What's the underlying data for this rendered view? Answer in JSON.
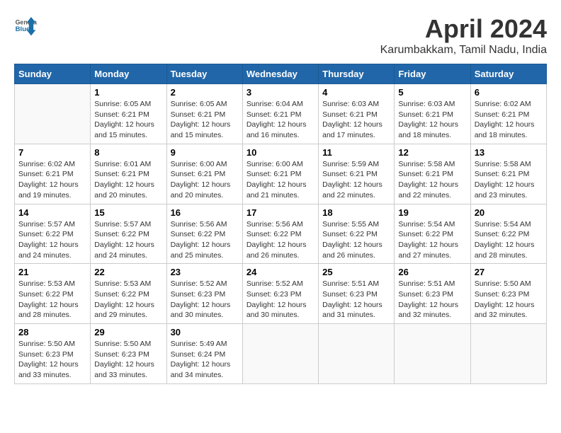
{
  "header": {
    "logo": {
      "line1": "General",
      "line2": "Blue"
    },
    "title": "April 2024",
    "location": "Karumbakkam, Tamil Nadu, India"
  },
  "weekdays": [
    "Sunday",
    "Monday",
    "Tuesday",
    "Wednesday",
    "Thursday",
    "Friday",
    "Saturday"
  ],
  "weeks": [
    [
      {
        "day": "",
        "sunrise": "",
        "sunset": "",
        "daylight": ""
      },
      {
        "day": "1",
        "sunrise": "6:05 AM",
        "sunset": "6:21 PM",
        "daylight": "12 hours and 15 minutes."
      },
      {
        "day": "2",
        "sunrise": "6:05 AM",
        "sunset": "6:21 PM",
        "daylight": "12 hours and 15 minutes."
      },
      {
        "day": "3",
        "sunrise": "6:04 AM",
        "sunset": "6:21 PM",
        "daylight": "12 hours and 16 minutes."
      },
      {
        "day": "4",
        "sunrise": "6:03 AM",
        "sunset": "6:21 PM",
        "daylight": "12 hours and 17 minutes."
      },
      {
        "day": "5",
        "sunrise": "6:03 AM",
        "sunset": "6:21 PM",
        "daylight": "12 hours and 18 minutes."
      },
      {
        "day": "6",
        "sunrise": "6:02 AM",
        "sunset": "6:21 PM",
        "daylight": "12 hours and 18 minutes."
      }
    ],
    [
      {
        "day": "7",
        "sunrise": "6:02 AM",
        "sunset": "6:21 PM",
        "daylight": "12 hours and 19 minutes."
      },
      {
        "day": "8",
        "sunrise": "6:01 AM",
        "sunset": "6:21 PM",
        "daylight": "12 hours and 20 minutes."
      },
      {
        "day": "9",
        "sunrise": "6:00 AM",
        "sunset": "6:21 PM",
        "daylight": "12 hours and 20 minutes."
      },
      {
        "day": "10",
        "sunrise": "6:00 AM",
        "sunset": "6:21 PM",
        "daylight": "12 hours and 21 minutes."
      },
      {
        "day": "11",
        "sunrise": "5:59 AM",
        "sunset": "6:21 PM",
        "daylight": "12 hours and 22 minutes."
      },
      {
        "day": "12",
        "sunrise": "5:58 AM",
        "sunset": "6:21 PM",
        "daylight": "12 hours and 22 minutes."
      },
      {
        "day": "13",
        "sunrise": "5:58 AM",
        "sunset": "6:21 PM",
        "daylight": "12 hours and 23 minutes."
      }
    ],
    [
      {
        "day": "14",
        "sunrise": "5:57 AM",
        "sunset": "6:22 PM",
        "daylight": "12 hours and 24 minutes."
      },
      {
        "day": "15",
        "sunrise": "5:57 AM",
        "sunset": "6:22 PM",
        "daylight": "12 hours and 24 minutes."
      },
      {
        "day": "16",
        "sunrise": "5:56 AM",
        "sunset": "6:22 PM",
        "daylight": "12 hours and 25 minutes."
      },
      {
        "day": "17",
        "sunrise": "5:56 AM",
        "sunset": "6:22 PM",
        "daylight": "12 hours and 26 minutes."
      },
      {
        "day": "18",
        "sunrise": "5:55 AM",
        "sunset": "6:22 PM",
        "daylight": "12 hours and 26 minutes."
      },
      {
        "day": "19",
        "sunrise": "5:54 AM",
        "sunset": "6:22 PM",
        "daylight": "12 hours and 27 minutes."
      },
      {
        "day": "20",
        "sunrise": "5:54 AM",
        "sunset": "6:22 PM",
        "daylight": "12 hours and 28 minutes."
      }
    ],
    [
      {
        "day": "21",
        "sunrise": "5:53 AM",
        "sunset": "6:22 PM",
        "daylight": "12 hours and 28 minutes."
      },
      {
        "day": "22",
        "sunrise": "5:53 AM",
        "sunset": "6:22 PM",
        "daylight": "12 hours and 29 minutes."
      },
      {
        "day": "23",
        "sunrise": "5:52 AM",
        "sunset": "6:23 PM",
        "daylight": "12 hours and 30 minutes."
      },
      {
        "day": "24",
        "sunrise": "5:52 AM",
        "sunset": "6:23 PM",
        "daylight": "12 hours and 30 minutes."
      },
      {
        "day": "25",
        "sunrise": "5:51 AM",
        "sunset": "6:23 PM",
        "daylight": "12 hours and 31 minutes."
      },
      {
        "day": "26",
        "sunrise": "5:51 AM",
        "sunset": "6:23 PM",
        "daylight": "12 hours and 32 minutes."
      },
      {
        "day": "27",
        "sunrise": "5:50 AM",
        "sunset": "6:23 PM",
        "daylight": "12 hours and 32 minutes."
      }
    ],
    [
      {
        "day": "28",
        "sunrise": "5:50 AM",
        "sunset": "6:23 PM",
        "daylight": "12 hours and 33 minutes."
      },
      {
        "day": "29",
        "sunrise": "5:50 AM",
        "sunset": "6:23 PM",
        "daylight": "12 hours and 33 minutes."
      },
      {
        "day": "30",
        "sunrise": "5:49 AM",
        "sunset": "6:24 PM",
        "daylight": "12 hours and 34 minutes."
      },
      {
        "day": "",
        "sunrise": "",
        "sunset": "",
        "daylight": ""
      },
      {
        "day": "",
        "sunrise": "",
        "sunset": "",
        "daylight": ""
      },
      {
        "day": "",
        "sunrise": "",
        "sunset": "",
        "daylight": ""
      },
      {
        "day": "",
        "sunrise": "",
        "sunset": "",
        "daylight": ""
      }
    ]
  ],
  "labels": {
    "sunrise_prefix": "Sunrise: ",
    "sunset_prefix": "Sunset: ",
    "daylight_prefix": "Daylight: "
  }
}
